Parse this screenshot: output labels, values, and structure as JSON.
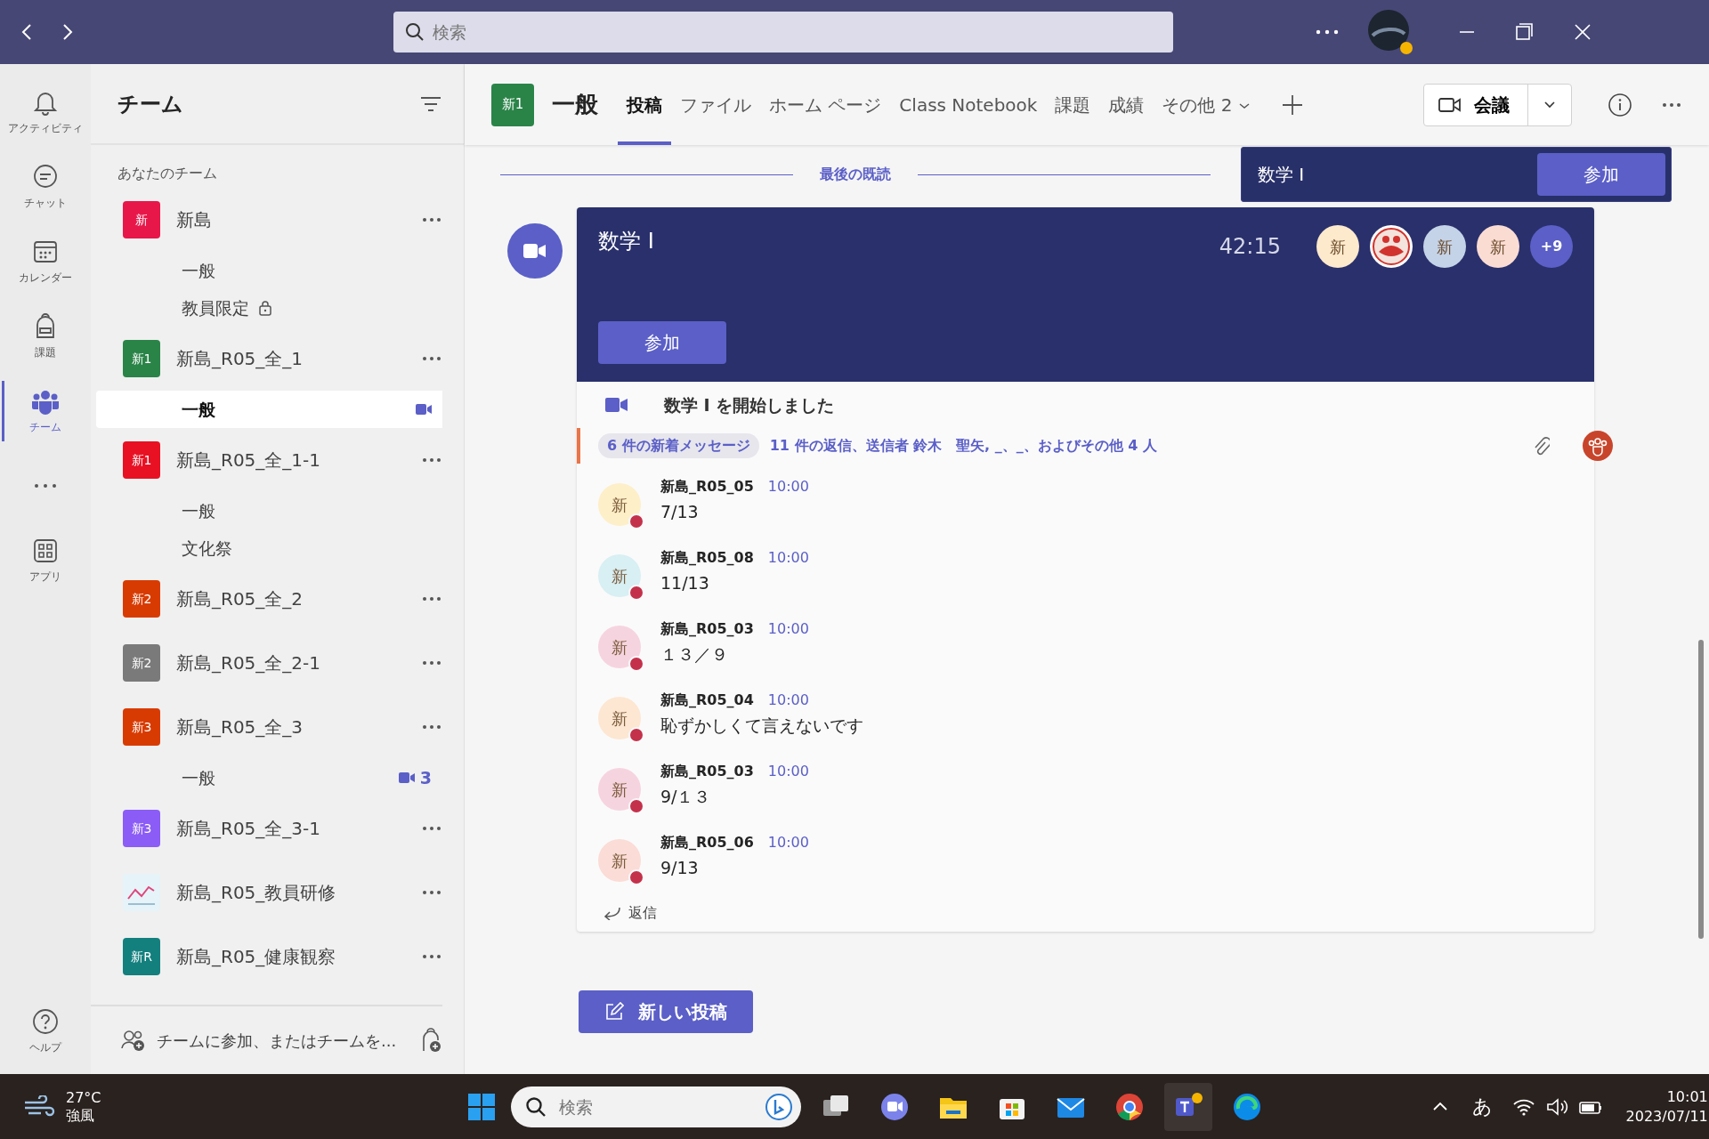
{
  "titlebar": {
    "search_placeholder": "検索"
  },
  "rail": [
    {
      "kind": "bell",
      "label": "アクティビティ",
      "selected": false
    },
    {
      "kind": "chat",
      "label": "チャット",
      "selected": false
    },
    {
      "kind": "calendar",
      "label": "カレンダー",
      "selected": false
    },
    {
      "kind": "bag",
      "label": "課題",
      "selected": false
    },
    {
      "kind": "teams",
      "label": "チーム",
      "selected": true
    },
    {
      "kind": "more",
      "selected": false
    },
    {
      "kind": "apps",
      "label": "アプリ",
      "selected": false
    }
  ],
  "rail_help": "ヘルプ",
  "teams_panel": {
    "title": "チーム",
    "section": "あなたのチーム",
    "join": "チームに参加、またはチームを...",
    "teams": [
      {
        "kind": "text",
        "badge": "新",
        "color": "#e8174a",
        "name": "新島",
        "channels": [
          {
            "name": "一般",
            "selected": false,
            "locked": false,
            "call": false
          },
          {
            "name": "教員限定",
            "selected": false,
            "locked": true,
            "call": false
          }
        ]
      },
      {
        "kind": "text",
        "badge": "新1",
        "color": "#2a8448",
        "name": "新島_R05_全_1",
        "channels": [
          {
            "name": "一般",
            "selected": true,
            "locked": false,
            "call": true
          }
        ]
      },
      {
        "kind": "text",
        "badge": "新1",
        "color": "#e81123",
        "name": "新島_R05_全_1-1",
        "channels": [
          {
            "name": "一般",
            "selected": false,
            "locked": false,
            "call": false
          },
          {
            "name": "文化祭",
            "selected": false,
            "locked": false,
            "call": false
          }
        ]
      },
      {
        "kind": "text",
        "badge": "新2",
        "color": "#d83b01",
        "name": "新島_R05_全_2"
      },
      {
        "kind": "text",
        "badge": "新2",
        "color": "#7a7a7a",
        "name": "新島_R05_全_2-1"
      },
      {
        "kind": "text",
        "badge": "新3",
        "color": "#d83b01",
        "name": "新島_R05_全_3",
        "channels": [
          {
            "name": "一般",
            "selected": false,
            "locked": false,
            "call": true,
            "call_count": "3"
          }
        ]
      },
      {
        "kind": "text",
        "badge": "新3",
        "color": "#8b5cf6",
        "name": "新島_R05_全_3-1"
      },
      {
        "kind": "chart",
        "name": "新島_R05_教員研修"
      },
      {
        "kind": "text",
        "badge": "新R",
        "color": "#13807e",
        "name": "新島_R05_健康観察"
      }
    ]
  },
  "channel_header": {
    "badge": "新1",
    "title": "一般",
    "meet_button": "会議",
    "tabs": [
      {
        "label": "投稿",
        "selected": true,
        "kind": "tab"
      },
      {
        "label": "ファイル",
        "selected": false,
        "kind": "tab"
      },
      {
        "label": "ホーム ページ",
        "selected": false,
        "kind": "tab"
      },
      {
        "label": "Class Notebook",
        "selected": false,
        "kind": "tab"
      },
      {
        "label": "課題",
        "selected": false,
        "kind": "tab"
      },
      {
        "label": "成績",
        "selected": false,
        "kind": "tab"
      },
      {
        "label": "その他 2",
        "selected": false,
        "kind": "more"
      }
    ]
  },
  "last_read": "最後の既読",
  "meeting_banner": {
    "title": "数学 Ⅰ",
    "join": "参加"
  },
  "meeting_card": {
    "title": "数学 Ⅰ",
    "duration": "42:15",
    "join": "参加",
    "more": "+9",
    "participants": [
      {
        "kind": "initial",
        "initial": "新",
        "color": "#fde9cc"
      },
      {
        "kind": "picture"
      },
      {
        "kind": "initial",
        "initial": "新",
        "color": "#c5d3e8"
      },
      {
        "kind": "initial",
        "initial": "新",
        "color": "#fbdcd3"
      }
    ],
    "started": "数学 Ⅰ を開始しました",
    "new_messages": "6 件の新着メッセージ",
    "replies_summary": "11 件の返信、送信者 鈴木　聖矢, _、_、およびその他 4 人",
    "replies": [
      {
        "author": "新島_R05_05",
        "time": "10:00",
        "text": "7/13",
        "initial": "新",
        "color": "#fdefc8"
      },
      {
        "author": "新島_R05_08",
        "time": "10:00",
        "text": "11/13",
        "initial": "新",
        "color": "#d8eff3"
      },
      {
        "author": "新島_R05_03",
        "time": "10:00",
        "text": "１３／９",
        "initial": "新",
        "color": "#f6d4df"
      },
      {
        "author": "新島_R05_04",
        "time": "10:00",
        "text": "恥ずかしくて言えないです",
        "initial": "新",
        "color": "#fde7d2"
      },
      {
        "author": "新島_R05_03",
        "time": "10:00",
        "text": "9/１３",
        "initial": "新",
        "color": "#f6d4df"
      },
      {
        "author": "新島_R05_06",
        "time": "10:00",
        "text": "9/13",
        "initial": "新",
        "color": "#fbdcd6"
      }
    ],
    "reply_button": "返信"
  },
  "new_post": "新しい投稿",
  "taskbar": {
    "temperature": "27°C",
    "weather": "強風",
    "search_placeholder": "検索",
    "ime": "あ",
    "time": "10:01",
    "date": "2023/07/11"
  }
}
